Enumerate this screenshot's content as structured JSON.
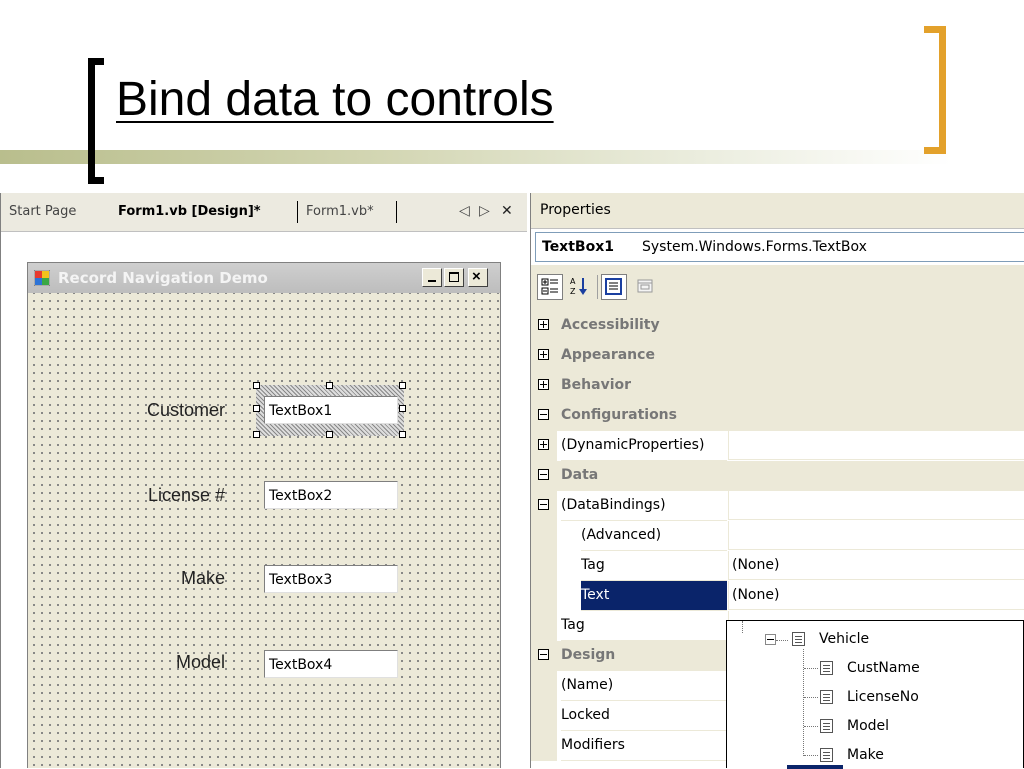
{
  "slide": {
    "title": "Bind data to controls"
  },
  "designer": {
    "tabs": [
      {
        "label": "Start Page"
      },
      {
        "label": "Form1.vb [Design]*"
      },
      {
        "label": "Form1.vb*"
      }
    ],
    "nav_left": "◁",
    "nav_right": "▷",
    "close": "✕"
  },
  "form": {
    "title": "Record Navigation Demo",
    "fields": [
      {
        "label": "Customer",
        "textbox": "TextBox1"
      },
      {
        "label": "License #",
        "textbox": "TextBox2"
      },
      {
        "label": "Make",
        "textbox": "TextBox3"
      },
      {
        "label": "Model",
        "textbox": "TextBox4"
      }
    ]
  },
  "properties": {
    "caption": "Properties",
    "object_name": "TextBox1",
    "object_type": "System.Windows.Forms.TextBox",
    "rows": [
      {
        "name": "Accessibility",
        "value": ""
      },
      {
        "name": "Appearance",
        "value": ""
      },
      {
        "name": "Behavior",
        "value": ""
      },
      {
        "name": "Configurations",
        "value": ""
      },
      {
        "name": "(DynamicProperties)",
        "value": ""
      },
      {
        "name": "Data",
        "value": ""
      },
      {
        "name": "(DataBindings)",
        "value": ""
      },
      {
        "name": "(Advanced)",
        "value": ""
      },
      {
        "name": "Tag",
        "value": "(None)"
      },
      {
        "name": "Text",
        "value": "(None)"
      },
      {
        "name": "Tag",
        "value": ""
      },
      {
        "name": "Design",
        "value": ""
      },
      {
        "name": "(Name)",
        "value": ""
      },
      {
        "name": "Locked",
        "value": ""
      },
      {
        "name": "Modifiers",
        "value": ""
      }
    ]
  },
  "binding_tree": {
    "parent": "Vehicle",
    "children": [
      "CustName",
      "LicenseNo",
      "Model",
      "Make"
    ]
  },
  "colors": {
    "selection": "#0a246a",
    "bracket_accent": "#e3a12b"
  }
}
